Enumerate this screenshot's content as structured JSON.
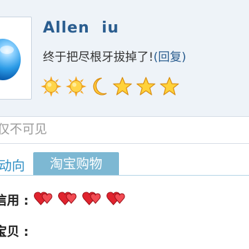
{
  "profile": {
    "username": "Allen  iu",
    "status_text": "终于把尽根牙拔掉了!",
    "reply_link": "(回复)",
    "rank_icons": [
      "sun-icon",
      "sun-icon",
      "moon-icon",
      "star-icon",
      "star-icon",
      "star-icon"
    ],
    "colors": {
      "username": "#2a5d8f",
      "card_background": "#eef3f8"
    }
  },
  "visibility_note": "仅不可见",
  "tabs": {
    "prev_label": "动向",
    "active_label": "淘宝购物",
    "active_color": "#7db8d3"
  },
  "credit": {
    "label": "信用 :",
    "icons": [
      "heart-icon",
      "heart-icon",
      "heart-icon",
      "heart-icon"
    ],
    "heart_color": "#e0232e"
  },
  "items": {
    "label": "宝贝 :"
  }
}
